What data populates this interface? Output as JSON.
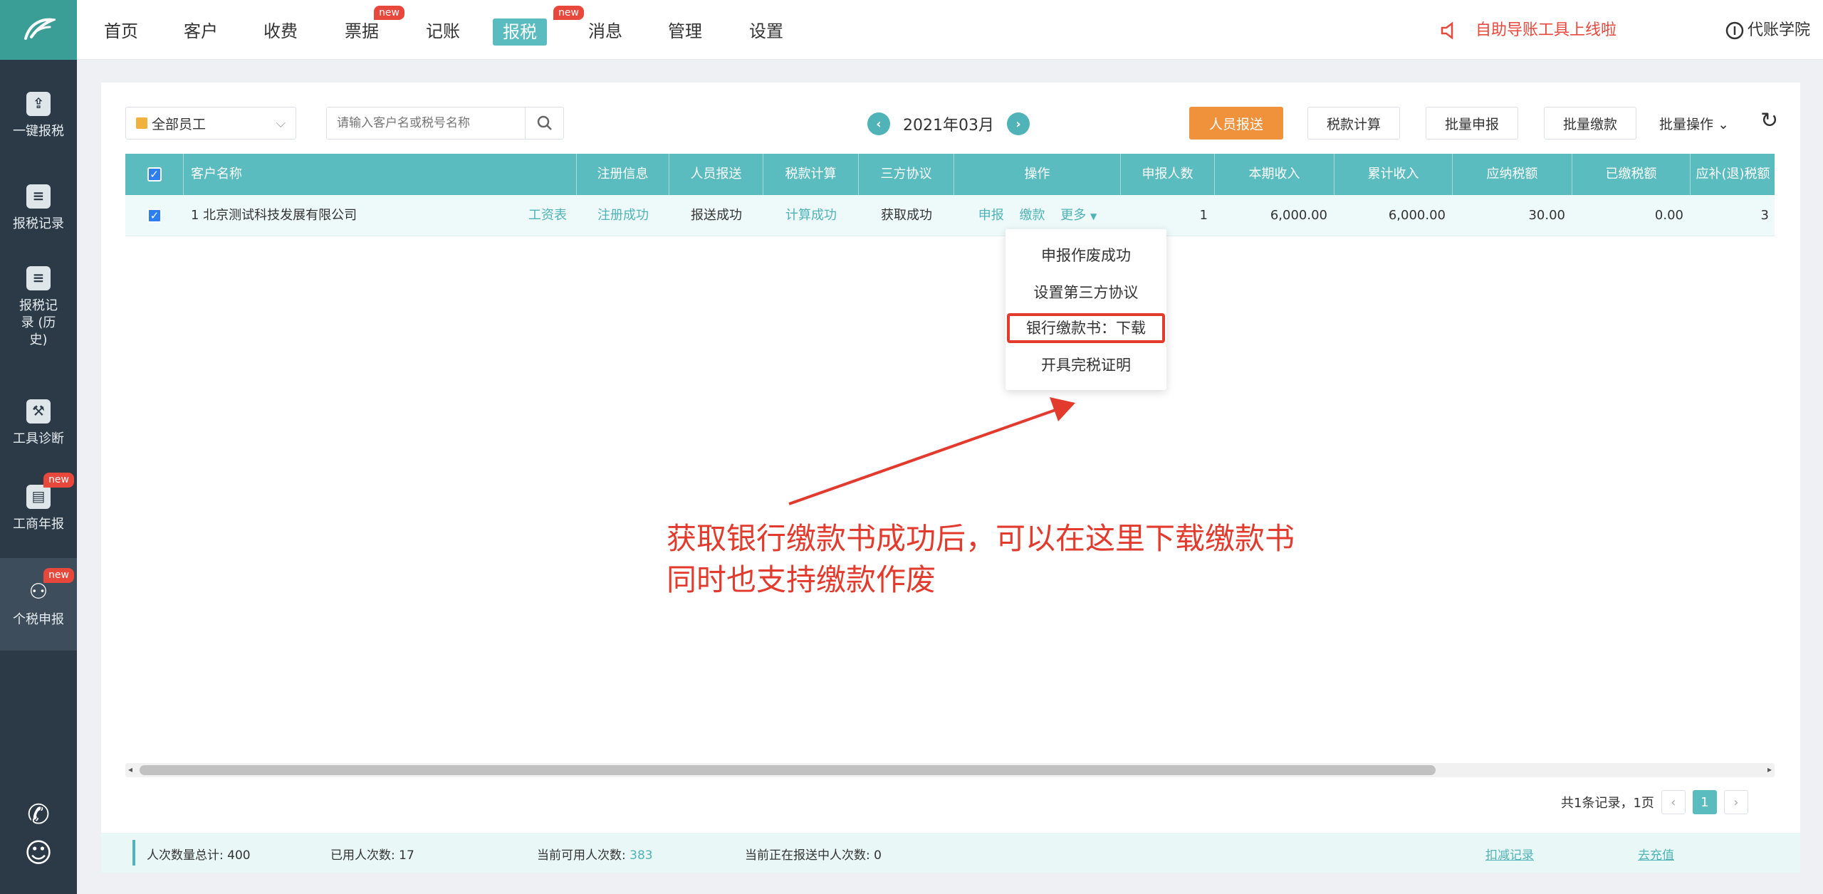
{
  "sidebar": {
    "items": [
      {
        "label": "一键报税",
        "icon": "upload-icon",
        "badge": ""
      },
      {
        "label": "报税记录",
        "icon": "record-icon",
        "badge": ""
      },
      {
        "label": "报税记录 (历史)",
        "icon": "history-record-icon",
        "badge": ""
      },
      {
        "label": "工具诊断",
        "icon": "tool-icon",
        "badge": ""
      },
      {
        "label": "工商年报",
        "icon": "annual-report-icon",
        "badge": "new"
      },
      {
        "label": "个税申报",
        "icon": "personal-tax-icon",
        "badge": "new"
      }
    ]
  },
  "topnav": {
    "items": [
      {
        "label": "首页",
        "badge": ""
      },
      {
        "label": "客户",
        "badge": ""
      },
      {
        "label": "收费",
        "badge": ""
      },
      {
        "label": "票据",
        "badge": "new"
      },
      {
        "label": "记账",
        "badge": ""
      },
      {
        "label": "报税",
        "badge": "new",
        "active": true
      },
      {
        "label": "消息",
        "badge": ""
      },
      {
        "label": "管理",
        "badge": ""
      },
      {
        "label": "设置",
        "badge": ""
      }
    ],
    "notice": "自助导账工具上线啦",
    "academy": "代账学院"
  },
  "toolbar": {
    "employee_select": "全部员工",
    "search_placeholder": "请输入客户名或税号名称",
    "month": "2021年03月",
    "btn_personnel": "人员报送",
    "btn_tax_calc": "税款计算",
    "btn_batch_declare": "批量申报",
    "btn_batch_deduct": "批量缴款",
    "btn_batch_ops": "批量操作"
  },
  "table": {
    "headers": [
      "",
      "客户名称",
      "注册信息",
      "人员报送",
      "税款计算",
      "三方协议",
      "操作",
      "申报人数",
      "本期收入",
      "累计收入",
      "应纳税额",
      "已缴税额",
      "应补(退)税额"
    ],
    "row": {
      "customer": "1 北京测试科技发展有限公司",
      "salary_tag": "工资表",
      "register": "注册成功",
      "personnel": "报送成功",
      "tax_calc": "计算成功",
      "tripartite": "获取成功",
      "op_declare": "申报",
      "op_pay": "缴款",
      "op_more": "更多",
      "declare_count": "1",
      "income": "6,000.00",
      "cumulative_income": "6,000.00",
      "tax_payable": "30.00",
      "tax_paid": "0.00",
      "tax_refund": "3"
    }
  },
  "dropdown": {
    "items": [
      "申报作废成功",
      "设置第三方协议",
      "银行缴款书：下载",
      "开具完税证明"
    ]
  },
  "annotation": {
    "line1": "获取银行缴款书成功后，可以在这里下载缴款书",
    "line2": "同时也支持缴款作废"
  },
  "pagination": {
    "summary": "共1条记录，1页",
    "current": "1"
  },
  "footer": {
    "total_label": "人次数量总计: ",
    "total": "400",
    "used_label": "已用人次数: ",
    "used": "17",
    "available_label": "当前可用人次数: ",
    "available": "383",
    "reporting_label": "当前正在报送中人次数: ",
    "reporting": "0",
    "link_records": "扣减记录",
    "link_recharge": "去充值"
  },
  "colors": {
    "sidebar": "#2c3a47",
    "teal": "#5bbcc0",
    "orange": "#f0913c",
    "red": "#e23b2e"
  }
}
